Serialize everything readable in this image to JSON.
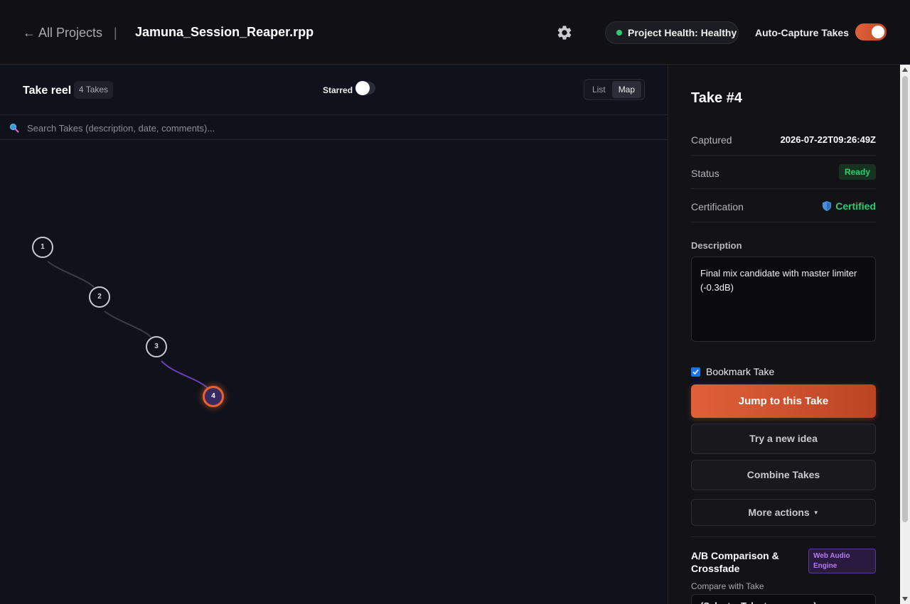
{
  "header": {
    "back_label": "← All Projects",
    "separator": "|",
    "project_file": "Jamuna_Session_Reaper.rpp",
    "health_label": "Project Health: Healthy",
    "auto_capture_label": "Auto-Capture Takes",
    "auto_capture_on": true
  },
  "reel": {
    "title": "Take reel",
    "count_label": "4 Takes",
    "starred_label": "Starred",
    "starred_on": false,
    "views": [
      "List",
      "Map"
    ],
    "active_view": "Map",
    "search_placeholder": "Search Takes (description, date, comments)..."
  },
  "map": {
    "nodes": [
      {
        "label": "1",
        "active": false
      },
      {
        "label": "2",
        "active": false
      },
      {
        "label": "3",
        "active": false
      },
      {
        "label": "4",
        "active": true
      }
    ]
  },
  "detail": {
    "title": "Take #4",
    "captured_label": "Captured",
    "captured_value": "2026-07-22T09:26:49Z",
    "status_label": "Status",
    "status_value": "Ready",
    "cert_label": "Certification",
    "cert_value": "Certified",
    "description_label": "Description",
    "description_value": "Final mix candidate with master limiter (-0.3dB)",
    "bookmark_label": "Bookmark Take",
    "bookmark_checked": true,
    "jump_button": "Jump to this Take",
    "try_button": "Try a new idea",
    "combine_button": "Combine Takes",
    "more_button": "More actions",
    "ab_title": "A/B Comparison & Crossfade",
    "engine_badge": "Web Audio Engine",
    "compare_label": "Compare with Take",
    "compare_value": "(Select a Take to compare)"
  },
  "colors": {
    "accent": "#e0603a",
    "ready": "#2ecc71",
    "engine": "#b47cf2",
    "active_node_fill": "#3a2a62"
  }
}
